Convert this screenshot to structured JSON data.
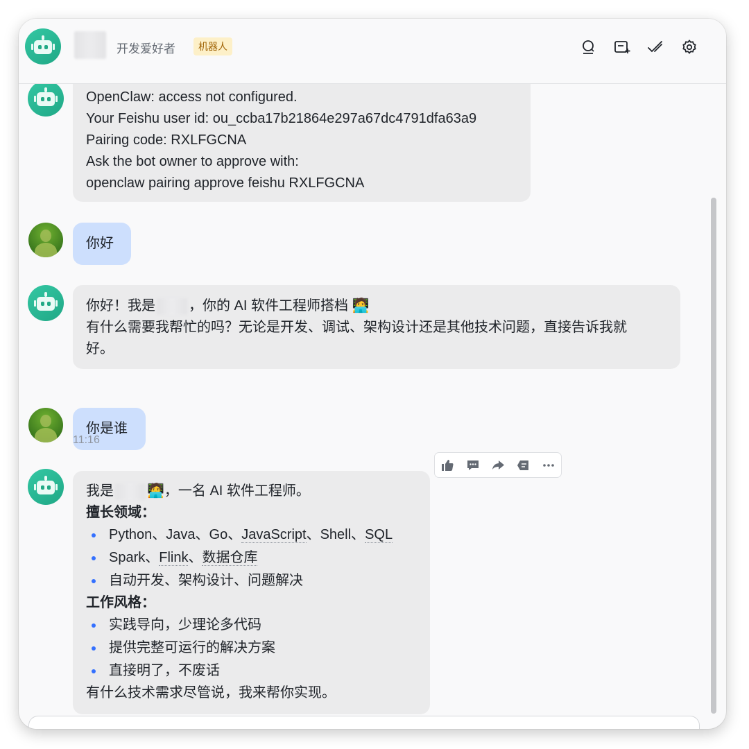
{
  "header": {
    "subtitle": "开发爱好者",
    "tag": "机器人",
    "icons": [
      "search-icon",
      "add-tab-icon",
      "checkmark-icon",
      "settings-icon"
    ]
  },
  "messages": {
    "m1": {
      "lines": [
        "OpenClaw: access not configured.",
        "Your Feishu user id: ou_ccba17b21864e297a67dc4791dfa63a9",
        "Pairing code: RXLFGCNA",
        "Ask the bot owner to approve with:",
        "openclaw pairing approve feishu RXLFGCNA"
      ]
    },
    "m2": {
      "text": "你好"
    },
    "m3": {
      "line1_prefix": "你好！我是",
      "line1_suffix": "，你的 AI 软件工程师搭档 🧑‍💻",
      "line2": "有什么需要我帮忙的吗？无论是开发、调试、架构设计还是其他技术问题，直接告诉我就",
      "line3": "好。"
    },
    "m4": {
      "text": "你是谁",
      "time": "11:16"
    },
    "m5": {
      "intro_prefix": "我是",
      "intro_suffix": "🧑‍💻，一名 AI 软件工程师。",
      "section1": "擅长领域：",
      "skills": {
        "s1": {
          "plain1": "Python、Java、Go、",
          "dotted1": "JavaScript",
          "plain2": "、Shell、",
          "dotted2": "SQL"
        },
        "s2": {
          "plain1": "Spark、",
          "dotted1": "Flink",
          "plain2": "、",
          "dotted2": "数据仓库"
        },
        "s3": "自动开发、架构设计、问题解决"
      },
      "section2": "工作风格：",
      "styles": [
        "实践导向，少理论多代码",
        "提供完整可运行的解决方案",
        "直接明了，不废话"
      ],
      "closing": "有什么技术需求尽管说，我来帮你实现。"
    }
  },
  "toolbar_icons": [
    "thumbs-up-icon",
    "comment-icon",
    "forward-icon",
    "reply-icon",
    "more-icon"
  ],
  "colors": {
    "accent": "#3370ff",
    "user_bubble": "#cddffd",
    "bot_bubble": "#ebebec",
    "tag_bg": "#fdf0c8"
  }
}
